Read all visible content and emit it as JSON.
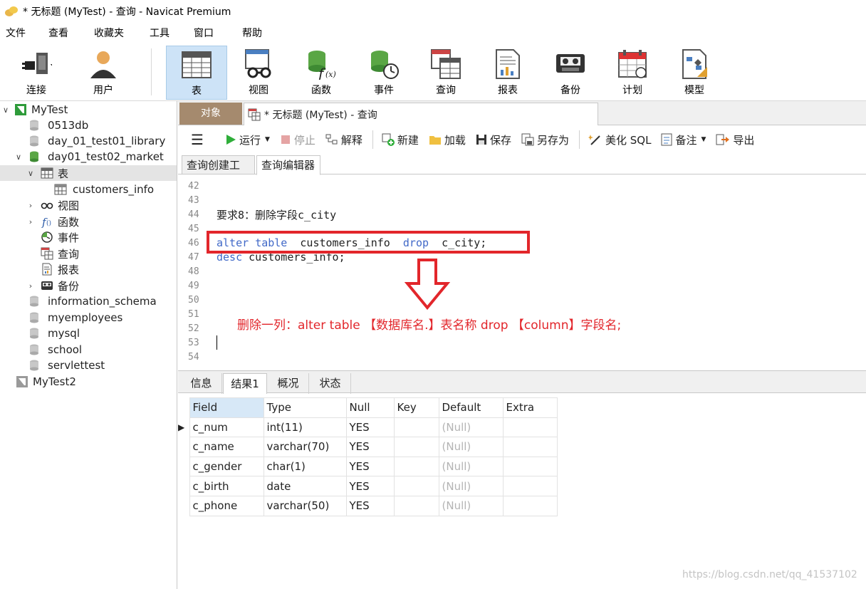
{
  "window": {
    "title": "* 无标题 (MyTest) - 查询 - Navicat Premium"
  },
  "menu": [
    "文件",
    "查看",
    "收藏夹",
    "工具",
    "窗口",
    "帮助"
  ],
  "toolbar": {
    "items": [
      {
        "label": "连接",
        "icon": "plug-icon"
      },
      {
        "label": "用户",
        "icon": "user-icon"
      },
      {
        "label": "表",
        "icon": "table-icon",
        "active": true
      },
      {
        "label": "视图",
        "icon": "glasses-icon"
      },
      {
        "label": "函数",
        "icon": "function-icon"
      },
      {
        "label": "事件",
        "icon": "event-clock-icon"
      },
      {
        "label": "查询",
        "icon": "query-icon"
      },
      {
        "label": "报表",
        "icon": "report-icon"
      },
      {
        "label": "备份",
        "icon": "backup-tape-icon"
      },
      {
        "label": "计划",
        "icon": "calendar-icon"
      },
      {
        "label": "模型",
        "icon": "model-icon"
      }
    ]
  },
  "sidebar": {
    "connections": [
      "MyTest",
      "MyTest2"
    ],
    "databases": [
      "0513db",
      "day_01_test01_library",
      "day01_test02_market",
      "information_schema",
      "myemployees",
      "mysql",
      "school",
      "servlettest"
    ],
    "market_children": {
      "tables_label": "表",
      "table_item": "customers_info",
      "others": [
        "视图",
        "函数",
        "事件",
        "查询",
        "报表",
        "备份"
      ]
    }
  },
  "tabs": {
    "objects": "对象",
    "query": "* 无标题 (MyTest) - 查询"
  },
  "query_toolbar": {
    "run": "运行",
    "stop": "停止",
    "explain": "解释",
    "new": "新建",
    "load": "加载",
    "save": "保存",
    "save_as": "另存为",
    "beautify": "美化 SQL",
    "notes": "备注",
    "export": "导出"
  },
  "subtabs": {
    "builder": "查询创建工具",
    "editor": "查询编辑器"
  },
  "editor": {
    "line_numbers": [
      "42",
      "43",
      "44",
      "45",
      "46",
      "47",
      "48",
      "49",
      "50",
      "51",
      "52",
      "53",
      "54"
    ],
    "comment_line": "要求8：删除字段c_city",
    "line46": {
      "kw1": "alter",
      "kw2": "table",
      "name": "customers_info",
      "kw3": "drop",
      "rest": "c_city;"
    },
    "line47": {
      "kw": "desc",
      "rest": "customers_info;"
    },
    "annotation": "删除一列：alter  table 【数据库名.】表名称  drop 【column】字段名;"
  },
  "result_tabs": [
    "信息",
    "结果1",
    "概况",
    "状态"
  ],
  "grid": {
    "columns": [
      "Field",
      "Type",
      "Null",
      "Key",
      "Default",
      "Extra"
    ],
    "rows": [
      [
        "c_num",
        "int(11)",
        "YES",
        "",
        "(Null)",
        ""
      ],
      [
        "c_name",
        "varchar(70)",
        "YES",
        "",
        "(Null)",
        ""
      ],
      [
        "c_gender",
        "char(1)",
        "YES",
        "",
        "(Null)",
        ""
      ],
      [
        "c_birth",
        "date",
        "YES",
        "",
        "(Null)",
        ""
      ],
      [
        "c_phone",
        "varchar(50)",
        "YES",
        "",
        "(Null)",
        ""
      ]
    ]
  },
  "watermark": "https://blog.csdn.net/qq_41537102"
}
